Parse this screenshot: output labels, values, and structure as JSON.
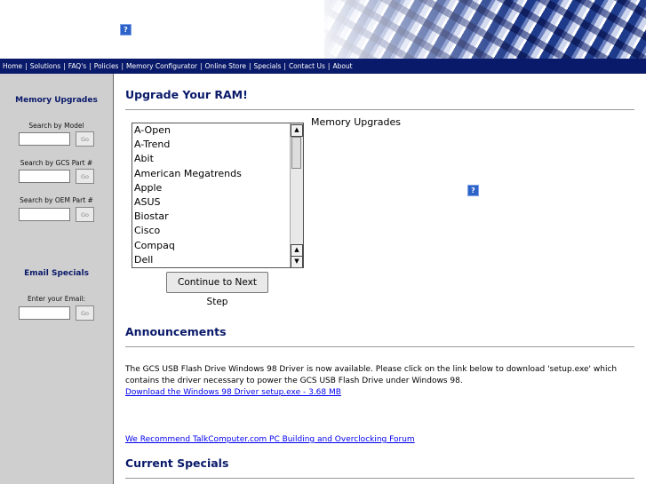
{
  "nav": {
    "items": [
      "Home",
      "Solutions",
      "FAQ's",
      "Policies",
      "Memory Configurator",
      "Online Store",
      "Specials",
      "Contact Us",
      "About"
    ],
    "separator": "|"
  },
  "header": {
    "help_icon": "?"
  },
  "sidebar": {
    "memory_upgrades_title": "Memory Upgrades",
    "search_model_label": "Search by Model",
    "search_gcs_label": "Search by GCS Part #",
    "search_oem_label": "Search by OEM Part #",
    "go_label": "Go",
    "email_specials_title": "Email Specials",
    "email_label": "Enter your Email:"
  },
  "upgrade": {
    "title": "Upgrade Your RAM!",
    "list_label": "Memory Upgrades",
    "manufacturers": [
      "A-Open",
      "A-Trend",
      "Abit",
      "American Megatrends",
      "Apple",
      "ASUS",
      "Biostar",
      "Cisco",
      "Compaq",
      "Dell"
    ],
    "continue_label": "Continue to Next Step",
    "help_icon": "?"
  },
  "announcements": {
    "title": "Announcements",
    "text": "The GCS USB Flash Drive Windows 98 Driver is now available. Please click on the link below to download 'setup.exe' which contains the driver necessary to power the GCS USB Flash Drive under Windows 98.",
    "download_link": "Download the Windows 98 Driver setup.exe - 3.68 MB",
    "forum_link": "We Recommend TalkComputer.com PC Building and Overclocking Forum"
  },
  "specials": {
    "title": "Current Specials"
  },
  "colors": {
    "nav_bg": "#0a1a6a",
    "heading": "#0a1a6a",
    "sidebar_bg": "#cfcfcf",
    "link": "#0000ee"
  }
}
